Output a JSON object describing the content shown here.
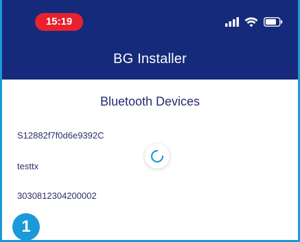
{
  "status_bar": {
    "time": "15:19",
    "icons": [
      "signal-icon",
      "wifi-icon",
      "battery-icon"
    ]
  },
  "header": {
    "title": "BG Installer"
  },
  "main": {
    "section_title": "Bluetooth Devices",
    "devices": [
      {
        "label": "S12882f7f0d6e9392C"
      },
      {
        "label": "testtx"
      },
      {
        "label": "3030812304200002"
      }
    ],
    "loading_indicator": "spinner-icon"
  },
  "annotation": {
    "step_number": "1"
  },
  "colors": {
    "header_bg": "#152a7a",
    "time_pill": "#e8212f",
    "accent": "#1a9ad6",
    "text_dark": "#232c70"
  }
}
